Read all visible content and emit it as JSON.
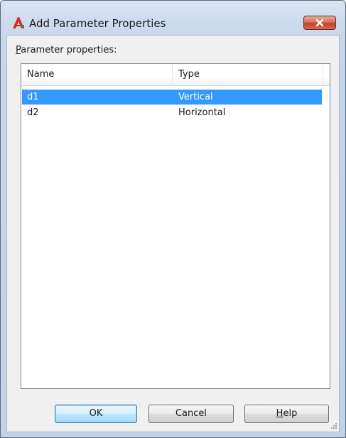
{
  "window": {
    "title": "Add Parameter Properties"
  },
  "section_label": "Parameter properties:",
  "list": {
    "columns": [
      {
        "label": "Name"
      },
      {
        "label": "Type"
      }
    ],
    "rows": [
      {
        "name": "d1",
        "type": "Vertical",
        "selected": true
      },
      {
        "name": "d2",
        "type": "Horizontal",
        "selected": false
      }
    ]
  },
  "buttons": {
    "ok": "OK",
    "cancel": "Cancel",
    "help": "Help"
  },
  "colors": {
    "selection": "#3399ff",
    "close_button": "#c3412a",
    "window_frame": "#c7d6ea"
  },
  "icons": {
    "app": "autocad-app-icon",
    "close": "close-icon",
    "resize": "resize-grip-icon"
  }
}
